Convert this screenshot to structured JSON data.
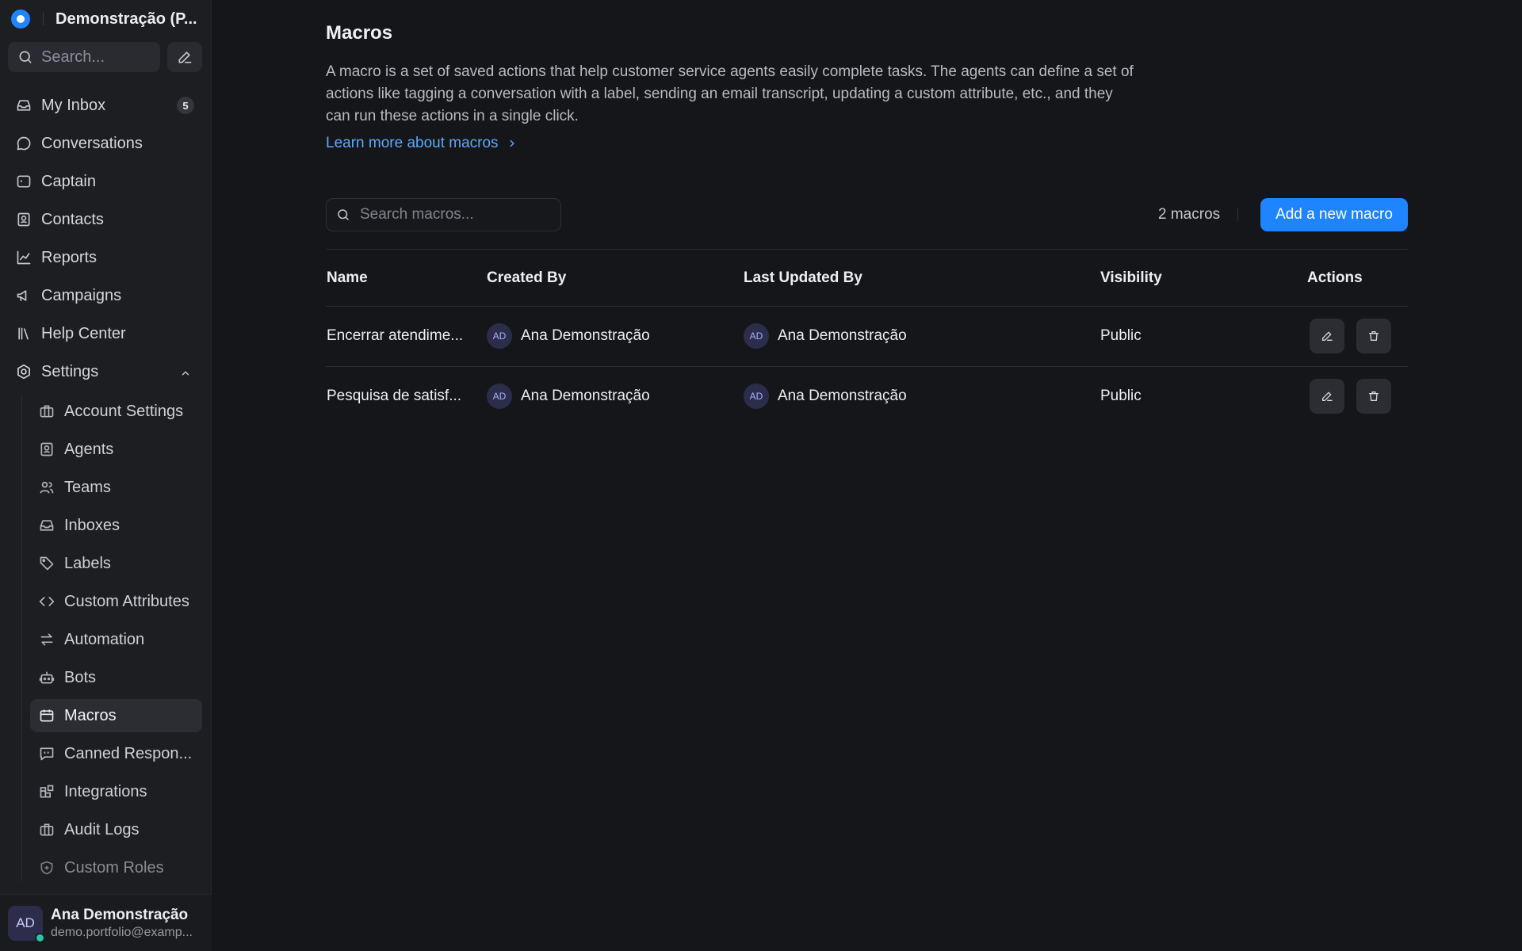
{
  "sidebar": {
    "account_name": "Demonstração (P...",
    "search_placeholder": "Search...",
    "nav": [
      {
        "label": "My Inbox",
        "icon": "inbox-icon",
        "badge": "5"
      },
      {
        "label": "Conversations",
        "icon": "chat-bubble-icon"
      },
      {
        "label": "Captain",
        "icon": "captain-icon"
      },
      {
        "label": "Contacts",
        "icon": "contacts-icon"
      },
      {
        "label": "Reports",
        "icon": "chart-line-icon"
      },
      {
        "label": "Campaigns",
        "icon": "megaphone-icon"
      },
      {
        "label": "Help Center",
        "icon": "library-icon"
      },
      {
        "label": "Settings",
        "icon": "settings-icon"
      }
    ],
    "settings_items": [
      {
        "label": "Account Settings",
        "icon": "briefcase-icon"
      },
      {
        "label": "Agents",
        "icon": "agent-icon"
      },
      {
        "label": "Teams",
        "icon": "users-icon"
      },
      {
        "label": "Inboxes",
        "icon": "inbox-icon"
      },
      {
        "label": "Labels",
        "icon": "tag-icon"
      },
      {
        "label": "Custom Attributes",
        "icon": "code-icon"
      },
      {
        "label": "Automation",
        "icon": "arrows-swap-icon"
      },
      {
        "label": "Bots",
        "icon": "robot-icon"
      },
      {
        "label": "Macros",
        "icon": "macro-icon",
        "active": true
      },
      {
        "label": "Canned Respon...",
        "icon": "canned-response-icon"
      },
      {
        "label": "Integrations",
        "icon": "integrations-icon"
      },
      {
        "label": "Audit Logs",
        "icon": "briefcase-icon"
      },
      {
        "label": "Custom Roles",
        "icon": "shield-icon"
      }
    ],
    "user": {
      "initials": "AD",
      "name": "Ana Demonstração",
      "email": "demo.portfolio@examp..."
    }
  },
  "main": {
    "title": "Macros",
    "description": "A macro is a set of saved actions that help customer service agents easily complete tasks. The agents can define a set of actions like tagging a conversation with a label, sending an email transcript, updating a custom attribute, etc., and they can run these actions in a single click.",
    "learn_more": "Learn more about macros",
    "search_placeholder": "Search macros...",
    "count": "2 macros",
    "add_button": "Add a new macro",
    "table": {
      "headers": [
        "Name",
        "Created By",
        "Last Updated By",
        "Visibility",
        "Actions"
      ],
      "rows": [
        {
          "name": "Encerrar atendime...",
          "created_initials": "AD",
          "created_by": "Ana Demonstração",
          "updated_initials": "AD",
          "updated_by": "Ana Demonstração",
          "visibility": "Public"
        },
        {
          "name": "Pesquisa de satisf...",
          "created_initials": "AD",
          "created_by": "Ana Demonstração",
          "updated_initials": "AD",
          "updated_by": "Ana Demonstração",
          "visibility": "Public"
        }
      ]
    }
  },
  "colors": {
    "accent": "#1f84ff",
    "link": "#5da8ff",
    "background": "#151619",
    "sidebar": "#1d1e22",
    "online": "#2bc6a6"
  }
}
